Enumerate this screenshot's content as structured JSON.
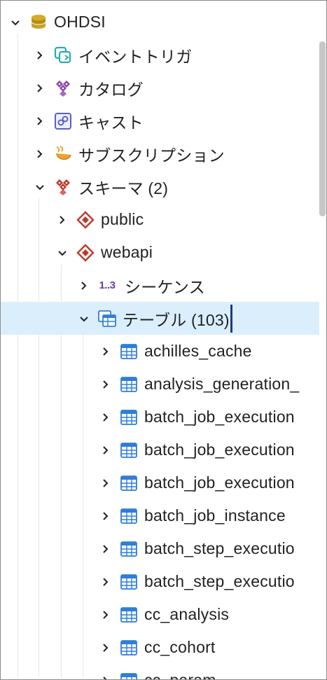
{
  "tree": {
    "root": {
      "label": "OHDSI"
    },
    "db_children": [
      {
        "label": "イベントトリガ"
      },
      {
        "label": "カタログ"
      },
      {
        "label": "キャスト"
      },
      {
        "label": "サブスクリプション"
      },
      {
        "label": "スキーマ (2)"
      }
    ],
    "schemas": [
      {
        "label": "public"
      },
      {
        "label": "webapi"
      }
    ],
    "webapi_children": [
      {
        "label": "シーケンス",
        "icon_text": "1..3"
      },
      {
        "label": "テーブル (103)"
      }
    ],
    "tables": [
      {
        "label": "achilles_cache"
      },
      {
        "label": "analysis_generation_"
      },
      {
        "label": "batch_job_execution"
      },
      {
        "label": "batch_job_execution"
      },
      {
        "label": "batch_job_execution"
      },
      {
        "label": "batch_job_instance"
      },
      {
        "label": "batch_step_executio"
      },
      {
        "label": "batch_step_executio"
      },
      {
        "label": "cc_analysis"
      },
      {
        "label": "cc_cohort"
      },
      {
        "label": "cc_param"
      }
    ]
  },
  "colors": {
    "selected_row": "#dbeefc",
    "table_icon": "#2f7ed8",
    "schema_icon": "#c0392b",
    "database_icon": "#c9a227",
    "catalog_icon": "#8e44ad"
  }
}
